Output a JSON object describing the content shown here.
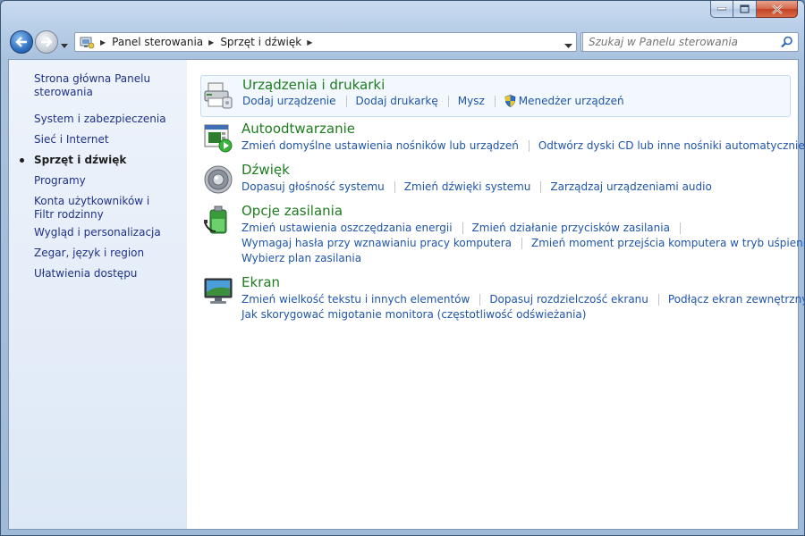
{
  "window": {
    "caption_buttons": [
      "minimize",
      "maximize",
      "close"
    ]
  },
  "nav": {
    "breadcrumbs": [
      "Panel sterowania",
      "Sprzęt i dźwięk"
    ],
    "search_placeholder": "Szukaj w Panelu sterowania",
    "icons": [
      "back-arrow-icon",
      "forward-arrow-icon",
      "control-panel-icon",
      "refresh-icon",
      "search-icon"
    ]
  },
  "sidebar": {
    "items": [
      {
        "label": "Strona główna Panelu sterowania",
        "current": false
      },
      {
        "label": "System i zabezpieczenia",
        "current": false
      },
      {
        "label": "Sieć i Internet",
        "current": false
      },
      {
        "label": "Sprzęt i dźwięk",
        "current": true
      },
      {
        "label": "Programy",
        "current": false
      },
      {
        "label": "Konta użytkowników i Filtr rodzinny",
        "current": false
      },
      {
        "label": "Wygląd i personalizacja",
        "current": false
      },
      {
        "label": "Zegar, język i region",
        "current": false
      },
      {
        "label": "Ułatwienia dostępu",
        "current": false
      }
    ]
  },
  "categories": [
    {
      "title": "Urządzenia i drukarki",
      "icon": "printer-icon",
      "links": [
        "Dodaj urządzenie",
        "Dodaj drukarkę",
        "Mysz",
        "Menedżer urządzeń"
      ]
    },
    {
      "title": "Autoodtwarzanie",
      "icon": "autoplay-icon",
      "links": [
        "Zmień domyślne ustawienia nośników lub urządzeń",
        "Odtwórz dyski CD lub inne nośniki automatycznie"
      ]
    },
    {
      "title": "Dźwięk",
      "icon": "speaker-icon",
      "links": [
        "Dopasuj głośność systemu",
        "Zmień dźwięki systemu",
        "Zarządzaj urządzeniami audio"
      ]
    },
    {
      "title": "Opcje zasilania",
      "icon": "battery-icon",
      "links": [
        "Zmień ustawienia oszczędzania energii",
        "Zmień działanie przycisków zasilania",
        "Wymagaj hasła przy wznawianiu pracy komputera",
        "Zmień moment przejścia komputera w tryb uśpienia",
        "Wybierz plan zasilania"
      ]
    },
    {
      "title": "Ekran",
      "icon": "monitor-icon",
      "links": [
        "Zmień wielkość tekstu i innych elementów",
        "Dopasuj rozdzielczość ekranu",
        "Podłącz ekran zewnętrzny",
        "Jak skorygować migotanie monitora (częstotliwość odświeżania)"
      ]
    }
  ],
  "colors": {
    "link": "#1f55aa",
    "category_title": "#1e7d1e",
    "sidebar_link": "#1e3287",
    "chrome": "#b9cfe8"
  }
}
